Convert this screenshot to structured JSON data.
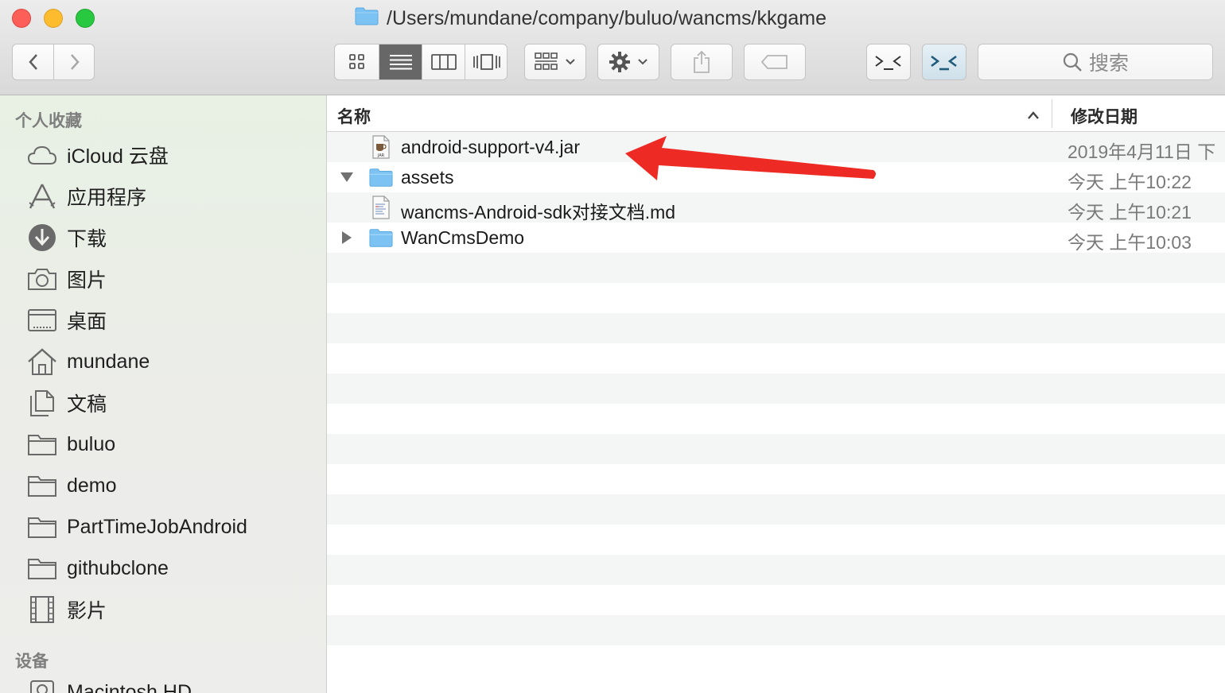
{
  "window": {
    "title": "/Users/mundane/company/buluo/wancms/kkgame"
  },
  "toolbar": {
    "view_modes": [
      "icon-view",
      "list-view",
      "column-view",
      "cover-flow-view"
    ],
    "active_view": "list-view",
    "search_placeholder": "搜索"
  },
  "sidebar": {
    "favorites_header": "个人收藏",
    "favorites": [
      {
        "label": "iCloud 云盘",
        "icon": "cloud-icon"
      },
      {
        "label": "应用程序",
        "icon": "applications-icon"
      },
      {
        "label": "下载",
        "icon": "download-icon"
      },
      {
        "label": "图片",
        "icon": "camera-icon"
      },
      {
        "label": "桌面",
        "icon": "desktop-icon"
      },
      {
        "label": "mundane",
        "icon": "home-icon"
      },
      {
        "label": "文稿",
        "icon": "documents-icon"
      },
      {
        "label": "buluo",
        "icon": "folder-icon"
      },
      {
        "label": "demo",
        "icon": "folder-icon"
      },
      {
        "label": "PartTimeJobAndroid",
        "icon": "folder-icon"
      },
      {
        "label": "githubclone",
        "icon": "folder-icon"
      },
      {
        "label": "影片",
        "icon": "film-icon"
      }
    ],
    "devices_header": "设备",
    "devices": [
      {
        "label": "Macintosh HD",
        "icon": "hard-drive-icon"
      }
    ]
  },
  "file_list": {
    "columns": {
      "name": "名称",
      "date_modified": "修改日期"
    },
    "sort": "ascending",
    "rows": [
      {
        "name": "android-support-v4.jar",
        "date": "2019年4月11日 下",
        "kind": "jar",
        "disclosure": "none"
      },
      {
        "name": "assets",
        "date": "今天 上午10:22",
        "kind": "folder",
        "disclosure": "expanded"
      },
      {
        "name": "wancms-Android-sdk对接文档.md",
        "date": "今天 上午10:21",
        "kind": "text",
        "disclosure": "none"
      },
      {
        "name": "WanCmsDemo",
        "date": "今天 上午10:03",
        "kind": "folder",
        "disclosure": "collapsed"
      }
    ],
    "empty_rows": 14
  },
  "annotation": {
    "arrow_color": "#ee2a24",
    "target": "android-support-v4.jar"
  },
  "colors": {
    "folder_blue": "#7cc3f4",
    "active_segment": "#676767",
    "close": "#fc5f57",
    "minimize": "#fdbc2e",
    "zoom": "#28c840"
  }
}
